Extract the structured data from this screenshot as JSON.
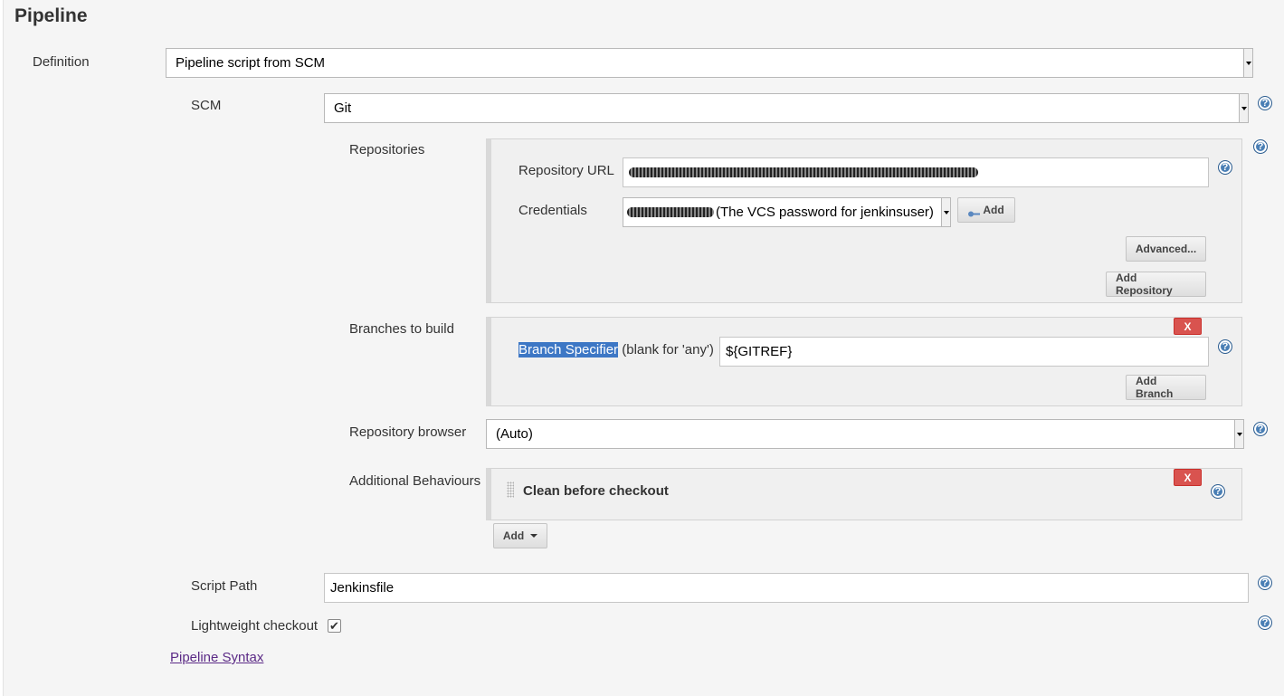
{
  "section": {
    "title": "Pipeline"
  },
  "definition": {
    "label": "Definition",
    "value": "Pipeline script from SCM"
  },
  "scm": {
    "label": "SCM",
    "value": "Git"
  },
  "repositories": {
    "label": "Repositories",
    "url_label": "Repository URL",
    "credentials_label": "Credentials",
    "credentials_value": "(The VCS password for jenkinsuser)",
    "add_label": "Add",
    "advanced_label": "Advanced...",
    "add_repository_label": "Add Repository"
  },
  "branches": {
    "label": "Branches to build",
    "remove_label": "X",
    "specifier_label": "Branch Specifier",
    "specifier_hint": "(blank for 'any')",
    "specifier_value": "${GITREF}",
    "add_branch_label": "Add Branch"
  },
  "repo_browser": {
    "label": "Repository browser",
    "value": "(Auto)"
  },
  "behaviours": {
    "label": "Additional Behaviours",
    "remove_label": "X",
    "item_label": "Clean before checkout",
    "add_label": "Add"
  },
  "script_path": {
    "label": "Script Path",
    "value": "Jenkinsfile"
  },
  "lightweight": {
    "label": "Lightweight checkout",
    "checked": true
  },
  "pipeline_syntax": {
    "label": "Pipeline Syntax"
  },
  "help_glyph": "?",
  "check_glyph": "✔",
  "colors": {
    "help": "#4a7fb5",
    "remove": "#d9534f",
    "link": "#5b2a86",
    "selection": "#3d77c5"
  },
  "icons": [
    "help-icon",
    "key-icon",
    "dropdown-arrow-icon",
    "drag-handle-icon",
    "check-icon"
  ]
}
